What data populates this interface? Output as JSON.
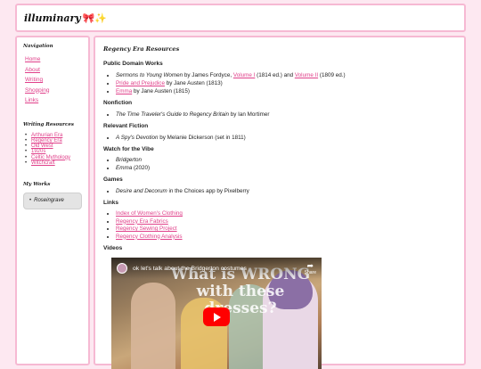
{
  "header": {
    "brand": "illuminary",
    "emoji": "🎀✨"
  },
  "sidebar": {
    "nav_heading": "Navigation",
    "nav": [
      "Home",
      "About",
      "Writing",
      "Shopping",
      "Links"
    ],
    "writing_heading": "Writing Resources",
    "writing": [
      "Arthurian Era",
      "Regency Era",
      "Old West",
      "1920s",
      "Celtic Mythology",
      "Witchcraft"
    ],
    "works_heading": "My Works",
    "works": [
      "Roseingrave"
    ]
  },
  "main": {
    "title": "Regency Era Resources",
    "public_domain": {
      "heading": "Public Domain Works",
      "item1": {
        "title": "Sermons to Young Women",
        "by": " by James Fordyce, ",
        "vol1": "Volume I",
        "mid": " (1814 ed.) and ",
        "vol2": "Volume II",
        "end": " (1809 ed.)"
      },
      "item2": {
        "link": "Pride and Prejudice",
        "rest": " by Jane Austen (1813)"
      },
      "item3": {
        "link": "Emma",
        "rest": " by Jane Austen (1815)"
      }
    },
    "nonfiction": {
      "heading": "Nonfiction",
      "item1": {
        "title": "The Time Traveler's Guide to Regency Britain",
        "rest": " by Ian Mortimer"
      }
    },
    "fiction": {
      "heading": "Relevant Fiction",
      "item1": {
        "title": "A Spy's Devotion",
        "rest": " by Melanie Dickerson (set in 1811)"
      }
    },
    "vibe": {
      "heading": "Watch for the Vibe",
      "item1": "Bridgerton",
      "item2": {
        "title": "Emma",
        "rest": " (2020)"
      }
    },
    "games": {
      "heading": "Games",
      "item1": {
        "title": "Desire and Decorum",
        "rest": " in the Choices app by Pixelberry"
      }
    },
    "links": {
      "heading": "Links",
      "items": [
        "Index of Women's Clothing",
        "Regency Era Fabrics",
        "Regency Sewing Project",
        "Regency Clothing Analysis"
      ]
    },
    "videos": {
      "heading": "Videos",
      "video_title": "ok let's talk about the Bridgerton costumes",
      "overlay_text": "What is WRONG with these dresses?",
      "share_label": "Share"
    }
  }
}
